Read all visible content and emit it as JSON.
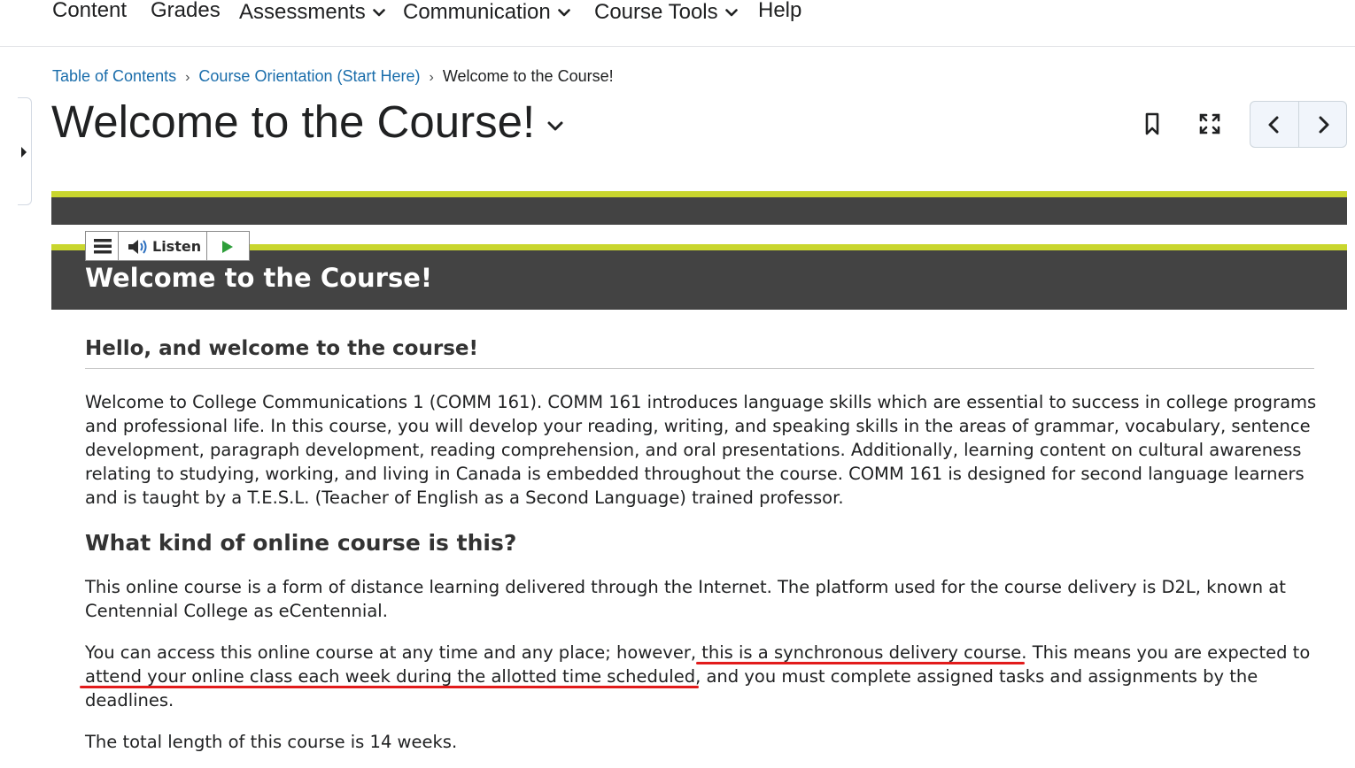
{
  "nav": {
    "items": [
      {
        "label": "Content"
      },
      {
        "label": "Grades"
      },
      {
        "label": "Assessments"
      },
      {
        "label": "Communication"
      },
      {
        "label": "Course Tools"
      },
      {
        "label": "Help"
      }
    ]
  },
  "breadcrumb": {
    "items": [
      "Table of Contents",
      "Course Orientation (Start Here)"
    ],
    "separator": "›",
    "current": "Welcome to the Course!"
  },
  "page": {
    "title": "Welcome to the Course!"
  },
  "listen_toolbar": {
    "listen_label": "Listen"
  },
  "banner": {
    "heading": "Welcome to the Course!"
  },
  "content": {
    "hello_heading": "Hello, and welcome to the course!",
    "intro_paragraph": "Welcome to College Communications 1 (COMM 161). COMM 161 introduces language skills which are essential to success in college programs and professional life. In this course, you will develop your reading, writing, and speaking skills in the areas of grammar, vocabulary, sentence development, paragraph development, reading comprehension, and oral presentations. Additionally, learning content on cultural awareness relating to studying, working, and living in Canada is embedded throughout the course. COMM 161 is designed for second language learners and is taught by a T.E.S.L. (Teacher of English as a Second Language) trained professor.",
    "what_heading": "What kind of online course is this?",
    "online_paragraph": "This online course is a form of distance learning delivered through the Internet. The platform used for the course delivery is D2L, known at Centennial College as eCentennial.",
    "access_paragraph": {
      "part1": "You can access this online course at any time and any place; however, ",
      "highlight1": "this is a synchronous delivery course",
      "part2": ". This means you are expected to ",
      "highlight2": "attend your online class each week during the allotted time scheduled",
      "part3": ", and you must complete assigned tasks and assignments by the deadlines."
    },
    "length_paragraph": "The total length of this course is 14 weeks."
  },
  "colors": {
    "accent_yellow": "#c9d62e",
    "banner_dark": "#434343",
    "link_blue": "#1a6dab",
    "annotation_red": "#e21b1b"
  },
  "icons": [
    "chevron-down-icon",
    "bookmark-icon",
    "fullscreen-icon",
    "chevron-left-icon",
    "chevron-right-icon",
    "menu-icon",
    "speaker-icon",
    "play-icon",
    "caret-right-icon"
  ]
}
